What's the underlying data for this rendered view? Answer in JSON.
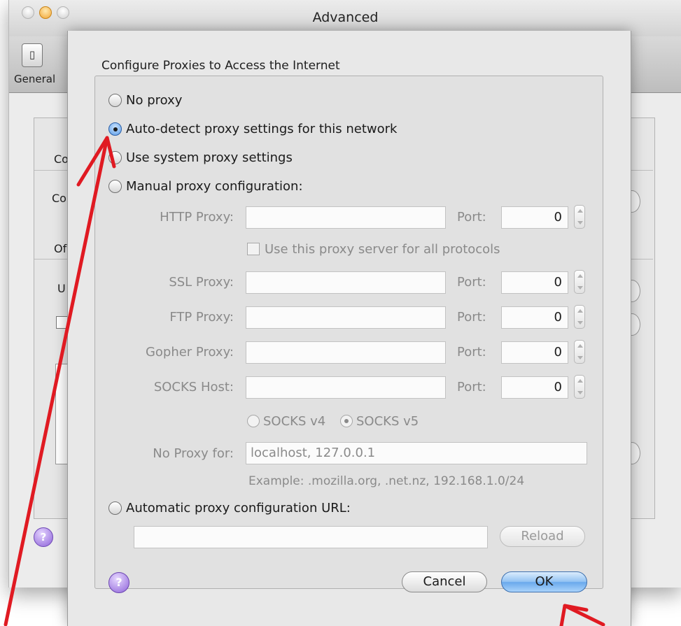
{
  "window": {
    "title": "Advanced",
    "toolbar": {
      "general_label": "General",
      "general_icon": "switch-icon"
    }
  },
  "parent_panel": {
    "labels": [
      "Co",
      "Co",
      "Of",
      "U"
    ]
  },
  "dialog": {
    "heading": "Configure Proxies to Access the Internet",
    "options": {
      "no_proxy": "No proxy",
      "auto_detect": "Auto-detect proxy settings for this network",
      "use_system": "Use system proxy settings",
      "manual": "Manual proxy configuration:",
      "auto_url": "Automatic proxy configuration URL:",
      "selected": "auto_detect"
    },
    "manual": {
      "port_label": "Port:",
      "http": {
        "label": "HTTP Proxy:",
        "value": "",
        "port": "0"
      },
      "use_for_all": "Use this proxy server for all protocols",
      "ssl": {
        "label": "SSL Proxy:",
        "value": "",
        "port": "0"
      },
      "ftp": {
        "label": "FTP Proxy:",
        "value": "",
        "port": "0"
      },
      "gopher": {
        "label": "Gopher Proxy:",
        "value": "",
        "port": "0"
      },
      "socks": {
        "label": "SOCKS Host:",
        "value": "",
        "port": "0"
      },
      "socks_v4": "SOCKS v4",
      "socks_v5": "SOCKS v5",
      "socks_selected": "v5",
      "no_proxy_label": "No Proxy for:",
      "no_proxy_value": "localhost, 127.0.0.1",
      "example": "Example: .mozilla.org, .net.nz, 192.168.1.0/24"
    },
    "auto_url_value": "",
    "buttons": {
      "reload": "Reload",
      "cancel": "Cancel",
      "ok": "OK",
      "help": "?"
    }
  },
  "colors": {
    "annotation": "#e01a22",
    "ok_button": "#7ab3ef",
    "selected_radio": "#5b9be6"
  }
}
